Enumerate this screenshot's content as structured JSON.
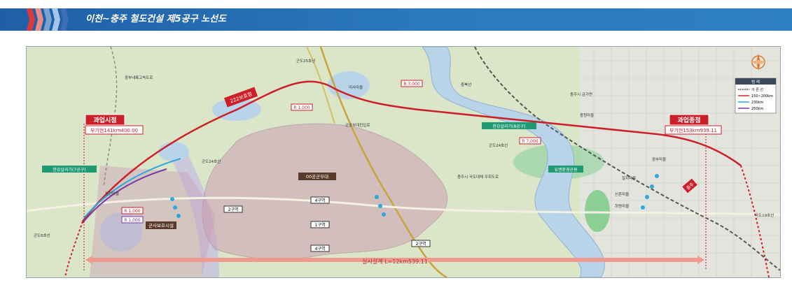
{
  "header": {
    "title": "이천~충주 철도건설 제5공구 노선도"
  },
  "map": {
    "start_label": "과업시점",
    "start_station": "부기현141km400.00",
    "end_label": "과업종점",
    "end_station": "부기현153km939.11",
    "section_badge": "222보호점",
    "extent_label": "실시설계 L=12km539.11",
    "military_area": "00공군부대",
    "military_facility": "군사보호시설",
    "district_labels": [
      "4구역",
      "2구역",
      "1구역",
      "4구역",
      "2구역"
    ],
    "radius_labels": [
      "R 3,000",
      "R 1,000",
      "R 7,000",
      "R 1,000",
      "R 1,000"
    ],
    "bridge_labels": [
      "한강살리기(7공구)",
      "한강살리기(8공구)",
      "유엔환경공원"
    ],
    "place_labels": [
      "군도25호선",
      "군도24호선",
      "군도24호선",
      "군도6호선",
      "국도19호선",
      "충북선",
      "중부내륙고속도로",
      "군공부대진입로",
      "충주시 국도대체 우회도로",
      "미사마을",
      "충청마을",
      "정천마을",
      "칠지마을",
      "신흔마을",
      "하령마을",
      "충주시 금가면",
      "중부마을"
    ],
    "side_badge": "충주",
    "legend": {
      "title": "범 례",
      "items": [
        {
          "label": "기 존 선",
          "color": "#555555"
        },
        {
          "label": "150~200km",
          "color": "#d7262c"
        },
        {
          "label": "230km",
          "color": "#2fa7e0"
        },
        {
          "label": "250km",
          "color": "#7b3aa3"
        }
      ]
    },
    "colors": {
      "route": "#cc1f28",
      "existing_line": "#555555",
      "river": "#b9d3e8",
      "military": "#caa0b5",
      "rail_north": "#c7a53b"
    }
  }
}
